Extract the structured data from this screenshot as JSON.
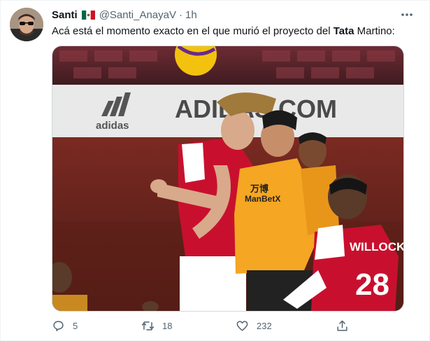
{
  "author": {
    "name": "Santi",
    "handle": "@Santi_AnayaV",
    "separator": "·",
    "time": "1h",
    "flag_icon": "mexico-flag-icon"
  },
  "tweet": {
    "text_before": "Acá está el momento exacto en el que murió el proyecto del ",
    "text_bold": "Tata",
    "text_after": " Martino:"
  },
  "media": {
    "board_text": "ADIDAS.COM",
    "board_brand": "adidas",
    "player_right_name": "WILLOCK",
    "player_right_number": "28",
    "shirt_sponsor": "ManBetX",
    "shirt_sponsor_zh": "万博",
    "colors": {
      "arsenal_red": "#c8102e",
      "wolves_orange": "#f5a623",
      "board_bg": "#e9e9e9"
    }
  },
  "actions": {
    "reply_count": "5",
    "retweet_count": "18",
    "like_count": "232",
    "reply_icon": "reply-icon",
    "retweet_icon": "retweet-icon",
    "like_icon": "heart-icon",
    "share_icon": "share-icon"
  }
}
